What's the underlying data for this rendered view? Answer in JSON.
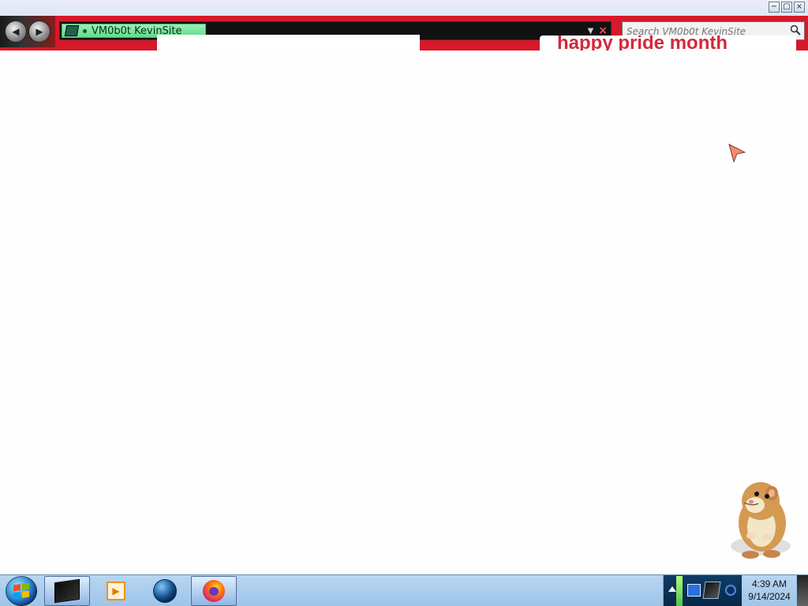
{
  "browser": {
    "address_site": "VM0b0t KevinSite",
    "search_placeholder": "Search VM0b0t KevinSite",
    "page_banner_text": "happy pride month"
  },
  "taskbar": {
    "time": "4:39 AM",
    "date": "9/14/2024"
  },
  "icons": {
    "window": [
      "minimize-icon",
      "restore-icon",
      "close-icon"
    ],
    "navigation": [
      "back-icon",
      "forward-icon",
      "search-icon",
      "dropdown-arrow-icon",
      "stop-icon"
    ],
    "taskbar_apps": [
      "terminal-icon",
      "media-player-icon",
      "globe-icon",
      "firefox-icon"
    ],
    "tray": [
      "show-hidden-icons-icon",
      "network-icon",
      "device-icon",
      "volume-icon"
    ],
    "desktop": [
      "cursor-icon",
      "hamster-icon"
    ]
  },
  "colors": {
    "nav_red": "#d7192a",
    "address_green": "#61dc86",
    "taskbar_blue": "#b8d6f1"
  }
}
